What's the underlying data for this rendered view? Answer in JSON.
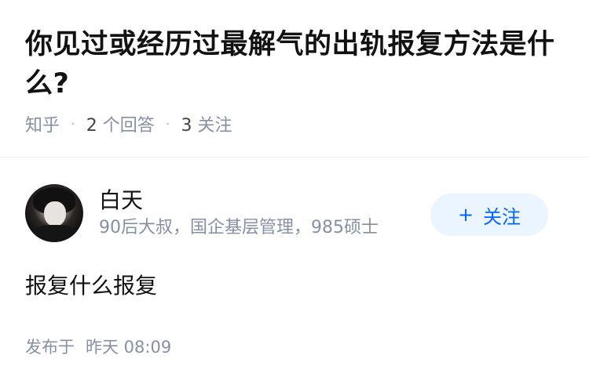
{
  "question": {
    "title": "你见过或经历过最解气的出轨报复方法是什么?",
    "source": "知乎",
    "answer_count": "2",
    "answer_label": "个回答",
    "follow_count": "3",
    "follow_label": "关注"
  },
  "answer": {
    "author_name": "白天",
    "author_desc": "90后大叔，国企基层管理，985硕士",
    "follow_button": {
      "icon": "+",
      "label": "关注"
    },
    "content": "报复什么报复",
    "published_label": "发布于",
    "published_time": "昨天 08:09"
  },
  "colors": {
    "accent": "#0066ff",
    "follow_bg": "#ebf5ff",
    "meta_gray": "#8590a6"
  }
}
